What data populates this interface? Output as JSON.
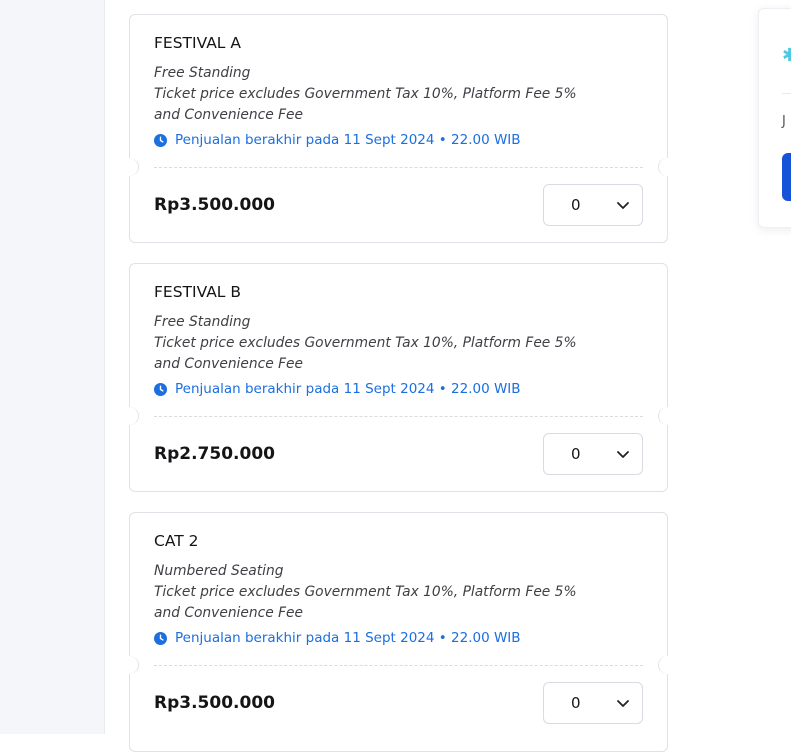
{
  "tickets": [
    {
      "name": "FESTIVAL A",
      "seating": "Free Standing",
      "note": "Ticket price excludes Government Tax 10%, Platform Fee 5% and Convenience Fee",
      "sale_end": "Penjualan berakhir pada 11 Sept 2024 • 22.00 WIB",
      "price": "Rp3.500.000",
      "quantity": "0"
    },
    {
      "name": "FESTIVAL B",
      "seating": "Free Standing",
      "note": "Ticket price excludes Government Tax 10%, Platform Fee 5% and Convenience Fee",
      "sale_end": "Penjualan berakhir pada 11 Sept 2024 • 22.00 WIB",
      "price": "Rp2.750.000",
      "quantity": "0"
    },
    {
      "name": "CAT 2",
      "seating": "Numbered Seating",
      "note": "Ticket price excludes Government Tax 10%, Platform Fee 5% and Convenience Fee",
      "sale_end": "Penjualan berakhir pada 11 Sept 2024 • 22.00 WIB",
      "price": "Rp3.500.000",
      "quantity": "0"
    }
  ],
  "sidebar": {
    "partial_text": "J",
    "icon": "ticket-star-icon"
  },
  "colors": {
    "accent": "#1b6fe0",
    "button": "#1553d8"
  }
}
